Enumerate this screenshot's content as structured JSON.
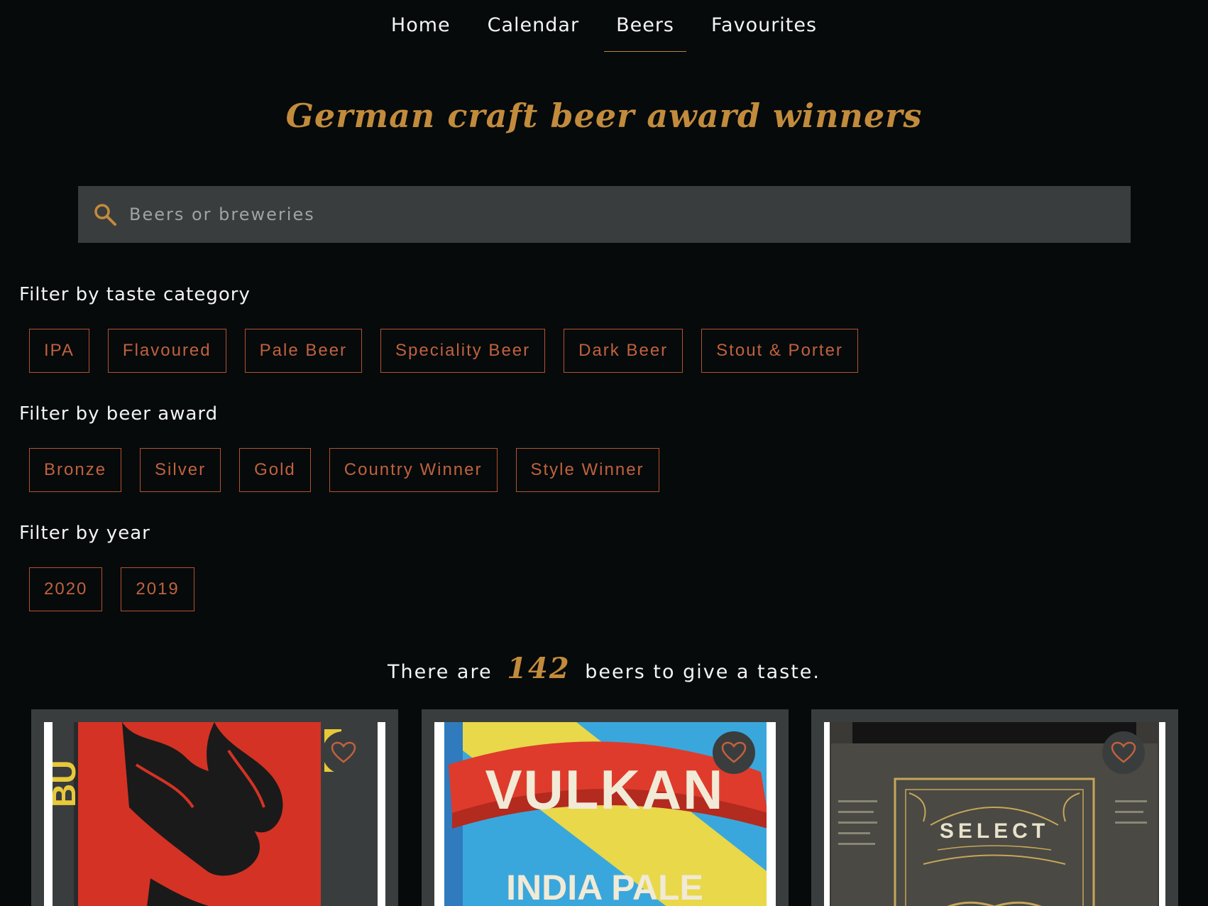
{
  "nav": {
    "items": [
      {
        "label": "Home"
      },
      {
        "label": "Calendar"
      },
      {
        "label": "Beers",
        "active": true
      },
      {
        "label": "Favourites"
      }
    ]
  },
  "page": {
    "title": "German craft beer award winners"
  },
  "search": {
    "placeholder": "Beers or breweries",
    "icon": "search-icon"
  },
  "filters": {
    "taste": {
      "heading": "Filter by taste category",
      "options": [
        "IPA",
        "Flavoured",
        "Pale Beer",
        "Speciality Beer",
        "Dark Beer",
        "Stout & Porter"
      ]
    },
    "award": {
      "heading": "Filter by beer award",
      "options": [
        "Bronze",
        "Silver",
        "Gold",
        "Country Winner",
        "Style Winner"
      ]
    },
    "year": {
      "heading": "Filter by year",
      "options": [
        "2020",
        "2019"
      ]
    }
  },
  "results": {
    "prefix": "There are",
    "count": "142",
    "suffix": "beers to give a taste."
  },
  "cards": [
    {
      "label_text": "BU",
      "favourite_icon": "heart-icon"
    },
    {
      "label_text": "VULKAN",
      "sub_text": "INDIA PALE",
      "favourite_icon": "heart-icon"
    },
    {
      "label_text": "SELECT",
      "favourite_icon": "heart-icon"
    }
  ],
  "colors": {
    "background": "#060a0b",
    "accent_gold": "#c28b3c",
    "chip_border": "#b3522f",
    "chip_text": "#c1613e",
    "panel": "#3a3d3d"
  }
}
